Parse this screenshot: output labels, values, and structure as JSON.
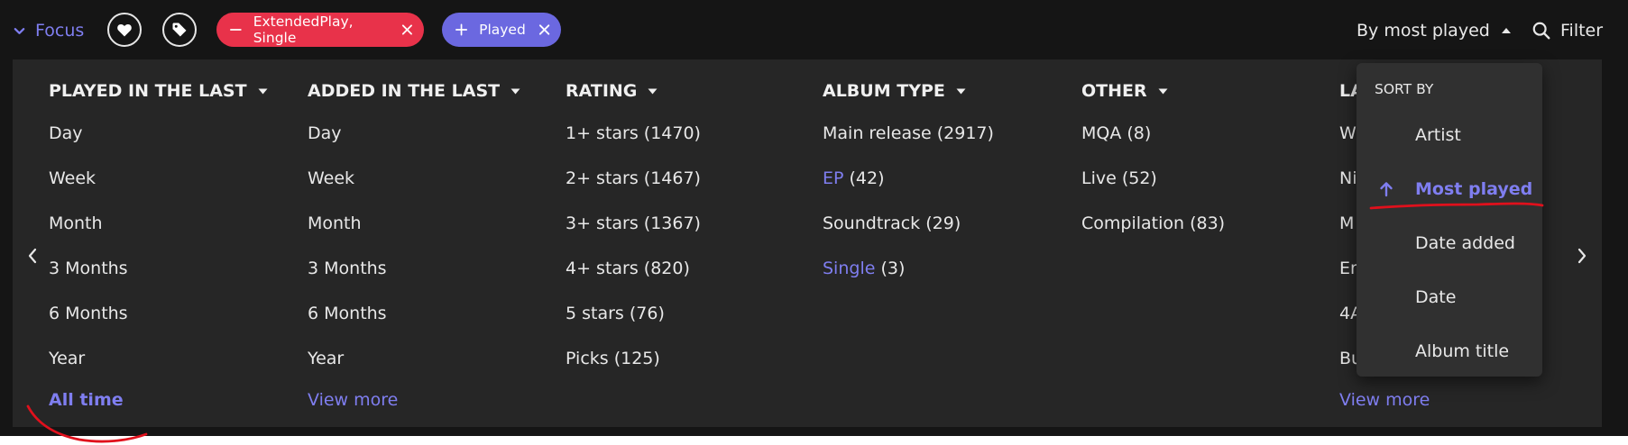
{
  "topbar": {
    "focus_label": "Focus",
    "favorite_icon": "heart-icon",
    "tag_icon": "tag-icon",
    "chips": [
      {
        "label": "ExtendedPlay, Single",
        "mode": "exclude",
        "color": "#e8324a"
      },
      {
        "label": "Played",
        "mode": "include",
        "color": "#6b68e0"
      }
    ],
    "sort_label": "By most played",
    "filter_label": "Filter"
  },
  "columns": [
    {
      "header": "PLAYED IN THE LAST",
      "items": [
        "Day",
        "Week",
        "Month",
        "3 Months",
        "6 Months",
        "Year"
      ],
      "footer": "All time"
    },
    {
      "header": "ADDED IN THE LAST",
      "items": [
        "Day",
        "Week",
        "Month",
        "3 Months",
        "6 Months",
        "Year"
      ],
      "footer": "View more"
    },
    {
      "header": "RATING",
      "items": [
        "1+ stars (1470)",
        "2+ stars (1467)",
        "3+ stars (1367)",
        "4+ stars (820)",
        "5 stars (76)",
        "Picks (125)"
      ]
    },
    {
      "header": "ALBUM TYPE",
      "items": [
        {
          "name": "Main release",
          "count": "(2917)"
        },
        {
          "name": "EP",
          "count": "(42)"
        },
        {
          "name": "Soundtrack",
          "count": "(29)"
        },
        {
          "name": "Single",
          "count": "(3)"
        }
      ]
    },
    {
      "header": "OTHER",
      "items": [
        "MQA (8)",
        "Live (52)",
        "Compilation (83)"
      ]
    },
    {
      "header": "LA",
      "items": [
        "W",
        "Ni",
        "M",
        "En",
        "4A",
        "Bu"
      ],
      "footer": "View more"
    }
  ],
  "sort_menu": {
    "title": "SORT BY",
    "options": [
      "Artist",
      "Most played",
      "Date added",
      "Date",
      "Album title"
    ],
    "selected": "Most played",
    "selected_icon": "arrow-up-icon"
  },
  "colors": {
    "accent": "#7f7ef0",
    "background": "#151515",
    "panel": "#262626",
    "menu": "#303030",
    "annotation": "#e0101c"
  }
}
